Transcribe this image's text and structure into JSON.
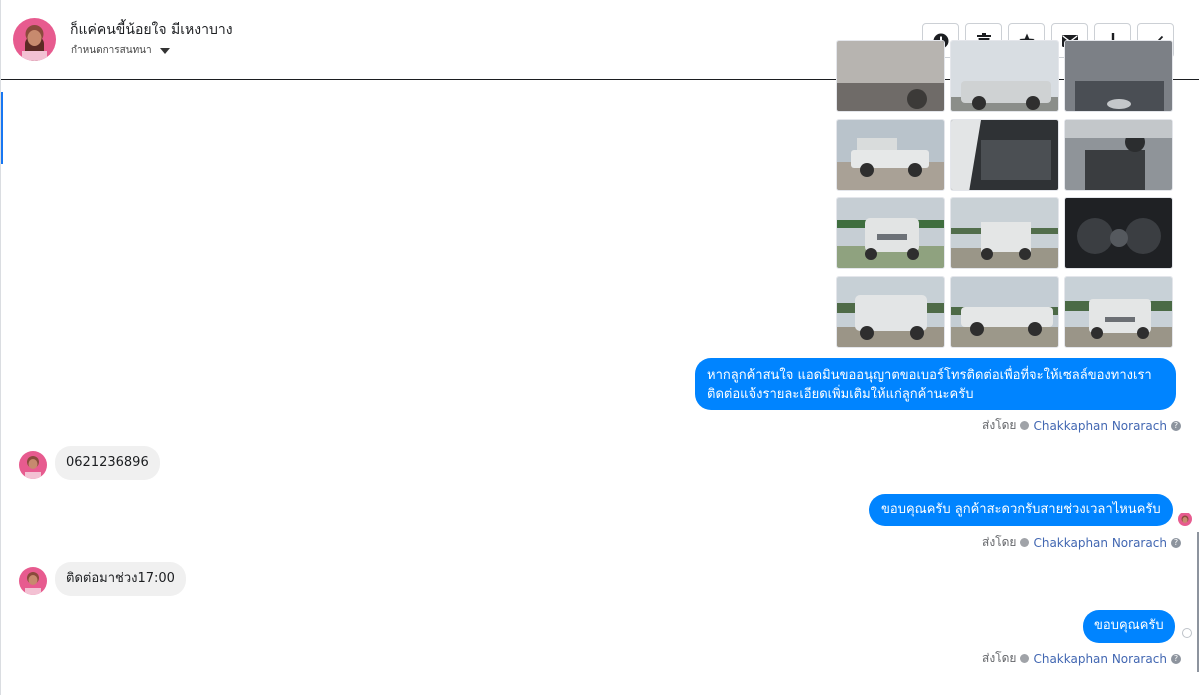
{
  "header": {
    "contact_name": "ก็แค่คนขี้น้อยใจ มีเหงาบาง",
    "assign_label": "กำหนดการสนทนา"
  },
  "toolbar": {
    "buttons": [
      "info-circle-icon",
      "trash-icon",
      "star-icon",
      "envelope-icon",
      "exclamation-icon",
      "check-icon"
    ]
  },
  "messages": [
    {
      "direction": "out",
      "text_line1": "หากลูกค้าสนใจ แอดมินขออนุญาตขอเบอร์โทรติดต่อเพื่อที่จะให้เซลล์ของทางเรา",
      "text_line2": "ติดต่อแจ้งรายละเอียดเพิ่มเติมให้แก่ลูกค้านะครับ",
      "sent_by_label": "ส่งโดย",
      "sender": "Chakkaphan Norarach"
    },
    {
      "direction": "in",
      "text": "0621236896"
    },
    {
      "direction": "out",
      "text": "ขอบคุณครับ ลูกค้าสะดวกรับสายช่วงเวลาไหนครับ",
      "sent_by_label": "ส่งโดย",
      "sender": "Chakkaphan Norarach"
    },
    {
      "direction": "in",
      "text": "ติดต่อมาช่วง17:00"
    },
    {
      "direction": "out",
      "text": "ขอบคุณครับ",
      "sent_by_label": "ส่งโดย",
      "sender": "Chakkaphan Norarach"
    }
  ],
  "colors": {
    "accent": "#0084ff",
    "incoming_bubble": "#f0f0f0",
    "sender_link": "#4267b2"
  }
}
